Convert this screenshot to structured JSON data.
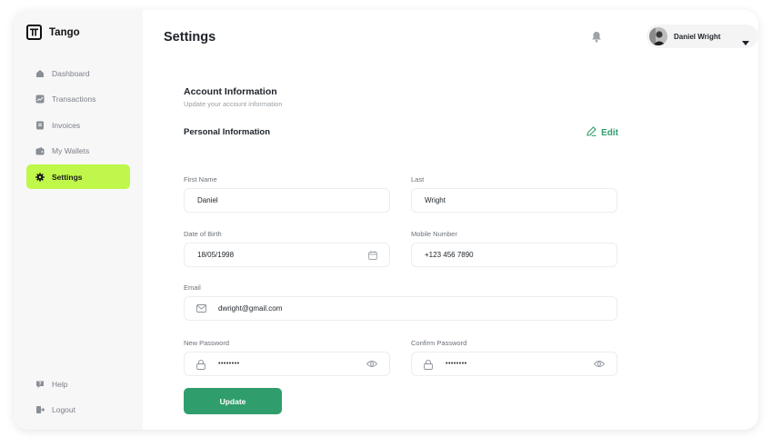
{
  "app": {
    "name": "Tango"
  },
  "sidebar": {
    "items": [
      {
        "label": "Dashboard",
        "icon": "home-icon"
      },
      {
        "label": "Transactions",
        "icon": "chart-icon"
      },
      {
        "label": "Invoices",
        "icon": "invoice-icon"
      },
      {
        "label": "My Wallets",
        "icon": "wallet-icon"
      },
      {
        "label": "Settings",
        "icon": "gear-icon",
        "active": true
      }
    ],
    "bottom": [
      {
        "label": "Help",
        "icon": "help-icon"
      },
      {
        "label": "Logout",
        "icon": "logout-icon"
      }
    ]
  },
  "header": {
    "title": "Settings",
    "user_name": "Daniel Wright"
  },
  "account": {
    "title": "Account Information",
    "subtitle": "Update your account information"
  },
  "personal": {
    "title": "Personal Information",
    "edit_label": "Edit"
  },
  "form": {
    "first_name": {
      "label": "First Name",
      "value": "Daniel"
    },
    "last_name": {
      "label": "Last",
      "value": "Wright"
    },
    "dob": {
      "label": "Date of Birth",
      "value": "18/05/1998"
    },
    "mobile": {
      "label": "Mobile Number",
      "value": "+123 456 7890"
    },
    "email": {
      "label": "Email",
      "value": "dwright@gmail.com"
    },
    "new_password": {
      "label": "New Password",
      "value": "••••••••"
    },
    "confirm_password": {
      "label": "Confirm Password",
      "value": "••••••••"
    }
  },
  "actions": {
    "update_label": "Update"
  },
  "colors": {
    "accent": "#2f9e6c",
    "active_nav": "#bff74a"
  }
}
